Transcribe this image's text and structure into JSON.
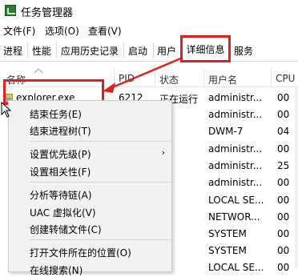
{
  "window": {
    "title": "任务管理器"
  },
  "menubar": {
    "file": "文件(F)",
    "options": "选项(O)",
    "view": "查看(V)"
  },
  "tabs": {
    "processes": "进程",
    "performance": "性能",
    "app_history": "应用历史记录",
    "startup": "启动",
    "users": "用户",
    "details": "详细信息",
    "services": "服务"
  },
  "columns": {
    "name": "名称",
    "pid": "PID",
    "status": "状态",
    "username": "用户名",
    "cpu": "CPU"
  },
  "rows": [
    {
      "name": "explorer.exe",
      "pid": "6212",
      "status": "正在运行",
      "username": "administr...",
      "cpu": "00"
    },
    {
      "username": "administr...",
      "cpu": "00"
    },
    {
      "username": "DWM-7",
      "cpu": "04"
    },
    {
      "username": "administr...",
      "cpu": "00"
    },
    {
      "username": "administr...",
      "cpu": "25"
    },
    {
      "username": "administr...",
      "cpu": "00"
    },
    {
      "username": "LOCAL SE...",
      "cpu": "00"
    },
    {
      "username": "NETWOR...",
      "cpu": "00"
    },
    {
      "username": "SYSTEM",
      "cpu": "00"
    },
    {
      "username": "SYSTEM",
      "cpu": "00"
    },
    {
      "username": "LOCAL SE...",
      "cpu": "00"
    },
    {
      "username": "administr...",
      "cpu": "00"
    }
  ],
  "context_menu": {
    "end_task": "结束任务(E)",
    "end_tree": "结束进程树(T)",
    "set_priority": "设置优先级(P)",
    "set_affinity": "设置相关性(F)",
    "analyze_wait_chain": "分析等待链(A)",
    "uac_virtualization": "UAC 虚拟化(V)",
    "create_dump": "创建转储文件(C)",
    "open_file_location": "打开文件所在的位置(O)",
    "search_online": "在线搜索(N)"
  },
  "colors": {
    "annotation": "#e01f1f"
  }
}
